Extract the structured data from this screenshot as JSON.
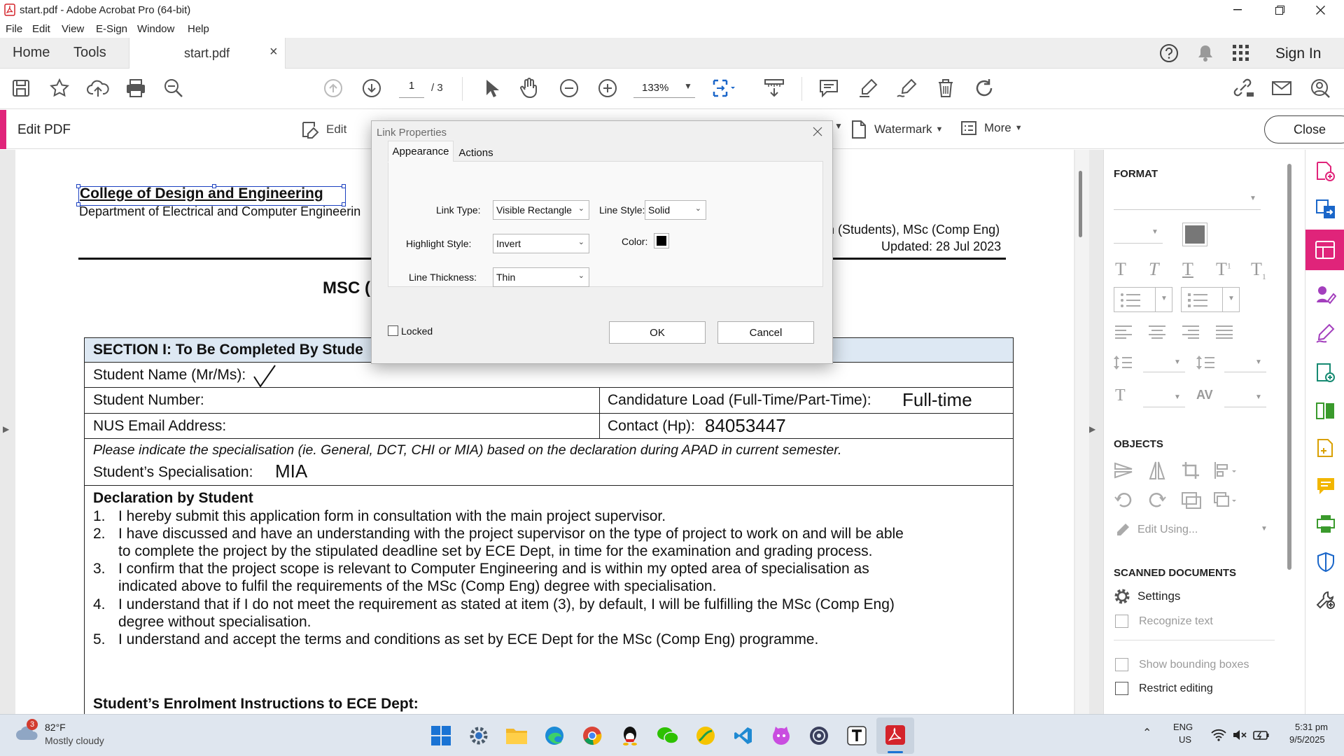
{
  "window": {
    "title": "start.pdf - Adobe Acrobat Pro (64-bit)"
  },
  "menu": [
    "File",
    "Edit",
    "View",
    "E-Sign",
    "Window",
    "Help"
  ],
  "tabs": {
    "home": "Home",
    "tools": "Tools",
    "document": "start.pdf",
    "close": "×"
  },
  "header": {
    "sign_in": "Sign In"
  },
  "toolbar": {
    "page_current": "1",
    "page_total": "/ 3",
    "zoom": "133%"
  },
  "editbar": {
    "title": "Edit PDF",
    "edit": "Edit",
    "watermark": "Watermark",
    "more": "More",
    "close": "Close"
  },
  "document": {
    "college": "College of Design and Engineering",
    "department": "Department of Electrical and Computer Engineerin",
    "right_line1": "n (Students), MSc (Comp Eng)",
    "right_line2": "Updated: 28 Jul 2023",
    "heading": "MSC (",
    "section_header": "SECTION I: To Be Completed By Stude",
    "student_name": "Student Name (Mr/Ms):",
    "student_number": "Student Number:",
    "candidature": "Candidature Load (Full-Time/Part-Time):",
    "candidature_value": "Full-time",
    "email": "NUS Email Address:",
    "contact": "Contact (Hp):",
    "contact_value": "84053447",
    "spec_note": "Please indicate the specialisation (ie. General, DCT, CHI or MIA) based on the declaration during APAD in current semester.",
    "spec_label": "Student’s Specialisation:",
    "spec_value": "MIA",
    "declaration_title": "Declaration by Student",
    "decl": [
      {
        "num": "1.",
        "l1": "I hereby submit this application form in consultation with the main project supervisor.",
        "l2": ""
      },
      {
        "num": "2.",
        "l1": "I have discussed and have an understanding with the project supervisor on the type of project to work on and will be able",
        "l2": "to complete the project by the stipulated deadline set by ECE Dept, in time for the examination and grading process."
      },
      {
        "num": "3.",
        "l1": "I confirm that the project scope is relevant to Computer Engineering and is within my opted area of specialisation as",
        "l2": "indicated above to fulfil the requirements of the MSc (Comp Eng) degree with specialisation."
      },
      {
        "num": "4.",
        "l1": "I understand that if I do not meet the requirement as stated at item (3), by default, I will be fulfilling the MSc (Comp Eng)",
        "l2": "degree without specialisation."
      },
      {
        "num": "5.",
        "l1": "I understand and accept the terms and conditions as set by ECE Dept for the MSc (Comp Eng) programme.",
        "l2": ""
      }
    ],
    "enrolment": "Student’s Enrolment Instructions to ECE Dept:"
  },
  "panel": {
    "format": "FORMAT",
    "objects": "OBJECTS",
    "edit_using": "Edit Using...",
    "scanned": "SCANNED DOCUMENTS",
    "settings": "Settings",
    "recognize": "Recognize text",
    "bounding": "Show bounding boxes",
    "restrict": "Restrict editing"
  },
  "dialog": {
    "title": "Link Properties",
    "tab_appearance": "Appearance",
    "tab_actions": "Actions",
    "link_type_label": "Link Type:",
    "link_type_value": "Visible Rectangle",
    "line_style_label": "Line Style:",
    "line_style_value": "Solid",
    "highlight_label": "Highlight Style:",
    "highlight_value": "Invert",
    "color_label": "Color:",
    "color_value": "#000000",
    "thickness_label": "Line Thickness:",
    "thickness_value": "Thin",
    "locked_label": "Locked",
    "ok": "OK",
    "cancel": "Cancel"
  },
  "taskbar": {
    "weather_temp": "82°F",
    "weather_desc": "Mostly cloudy",
    "weather_badge": "3",
    "lang1": "ENG",
    "lang2": "US",
    "time": "5:31 pm",
    "date": "9/5/2025"
  },
  "colors": {
    "accent": "#e0247a",
    "link_select": "#1a3fbf",
    "section_bg": "#dde8f3"
  }
}
